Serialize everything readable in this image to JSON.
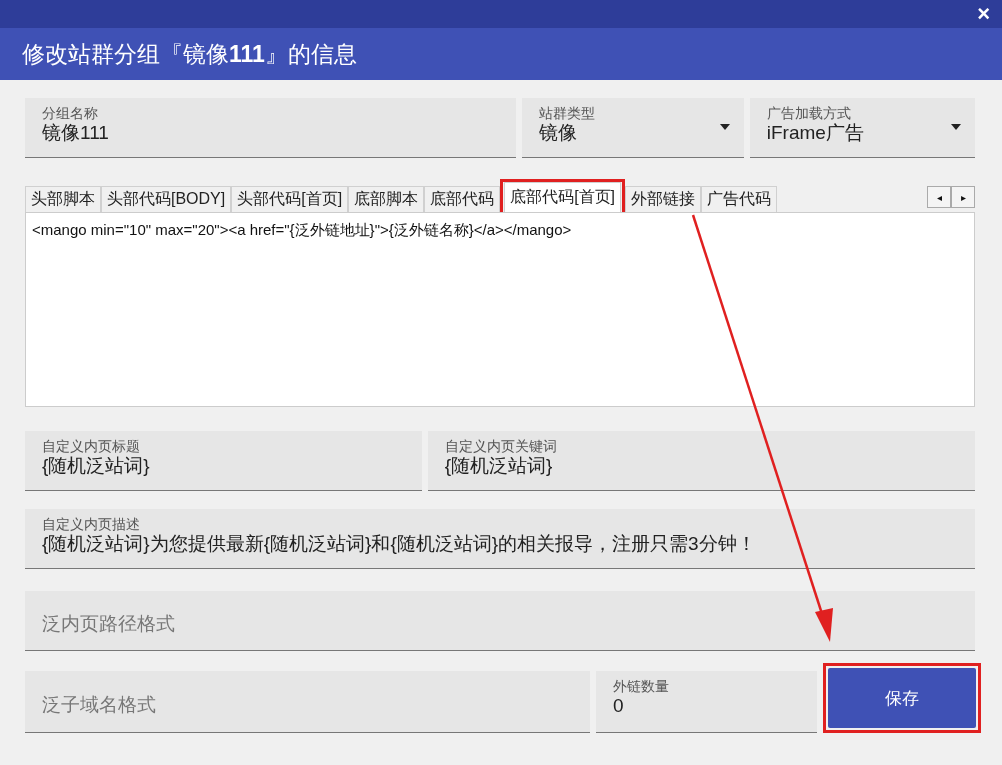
{
  "window": {
    "title": "修改站群分组『镜像**111**』的信息",
    "close": "×"
  },
  "top_fields": [
    {
      "kind": "text",
      "label": "分组名称",
      "value": "镜像111"
    },
    {
      "kind": "select",
      "label": "站群类型",
      "value": "镜像"
    },
    {
      "kind": "select",
      "label": "广告加载方式",
      "value": "iFrame广告"
    }
  ],
  "tabs": [
    {
      "label": "头部脚本",
      "selected": false,
      "highlighted": false
    },
    {
      "label": "头部代码[BODY]",
      "selected": false,
      "highlighted": false
    },
    {
      "label": "头部代码[首页]",
      "selected": false,
      "highlighted": false
    },
    {
      "label": "底部脚本",
      "selected": false,
      "highlighted": false
    },
    {
      "label": "底部代码",
      "selected": false,
      "highlighted": false
    },
    {
      "label": "底部代码[首页]",
      "selected": true,
      "highlighted": true
    },
    {
      "label": "外部链接",
      "selected": false,
      "highlighted": false
    },
    {
      "label": "广告代码",
      "selected": false,
      "highlighted": false
    }
  ],
  "tab_scroll": [
    "◂",
    "▸"
  ],
  "code": "<mango min=\"10\" max=\"20\"><a href=\"{泛外链地址}\">{泛外链名称}</a></mango>",
  "meta_fields": [
    {
      "label": "自定义内页标题",
      "value": "{随机泛站词}"
    },
    {
      "label": "自定义内页关键词",
      "value": "{随机泛站词}"
    }
  ],
  "description": {
    "label": "自定义内页描述",
    "value": "{随机泛站词}为您提供最新{随机泛站词}和{随机泛站词}的相关报导，注册只需3分钟！"
  },
  "path_format": {
    "placeholder": "泛内页路径格式"
  },
  "subdomain_format": {
    "placeholder": "泛子域名格式"
  },
  "link_count": {
    "label": "外链数量",
    "value": "0"
  },
  "save_button": {
    "label": "保存",
    "highlighted": true
  }
}
